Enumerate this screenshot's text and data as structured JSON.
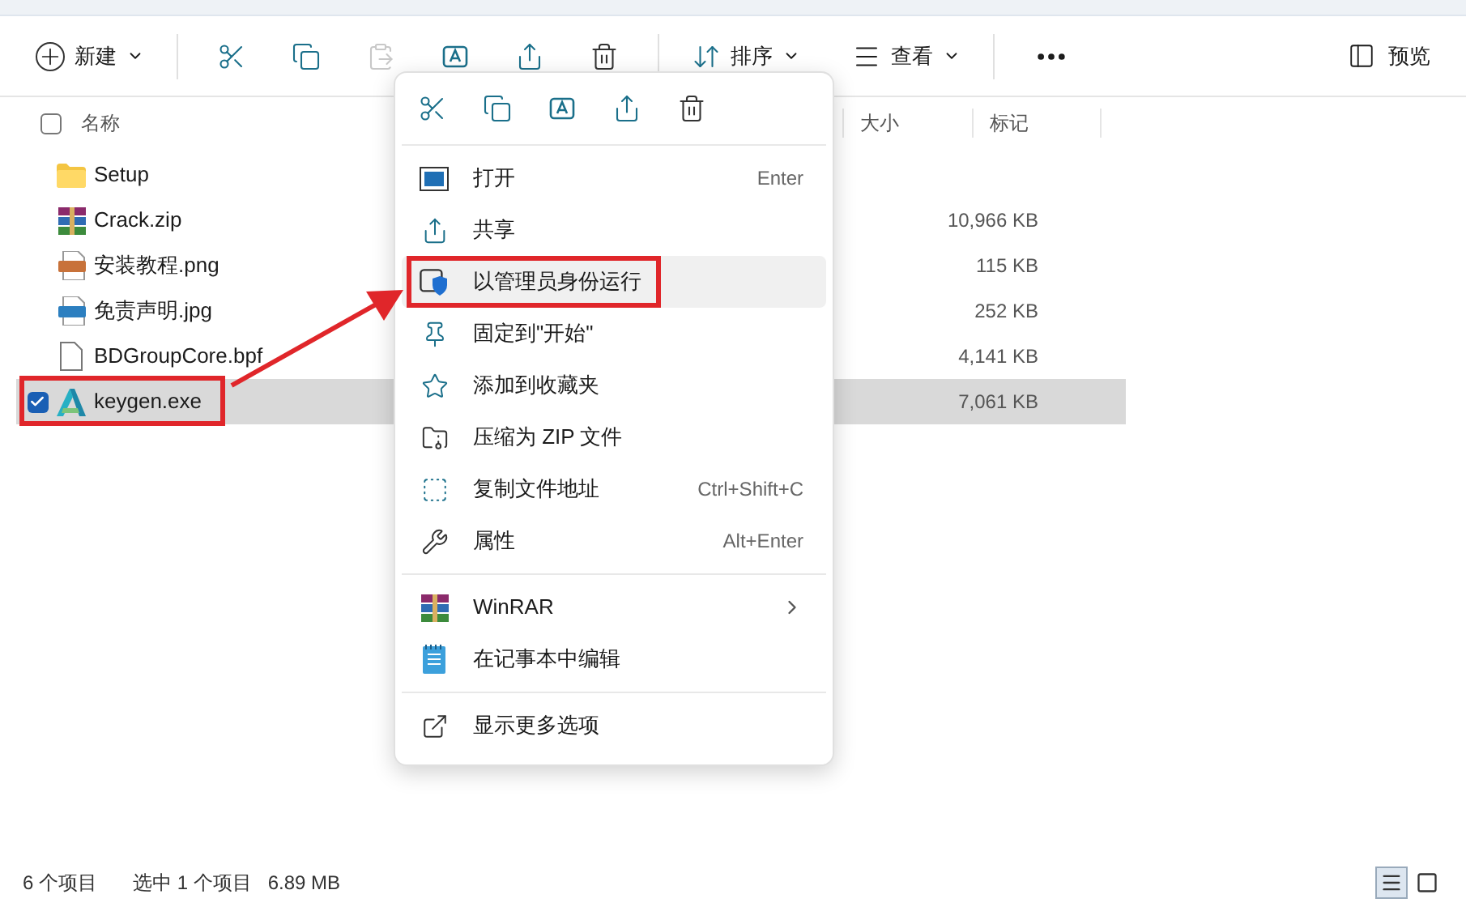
{
  "toolbar": {
    "new_label": "新建",
    "sort_label": "排序",
    "view_label": "查看",
    "preview_label": "预览"
  },
  "select_all_checked": false,
  "columns": [
    "名称",
    "大小",
    "标记"
  ],
  "files": [
    {
      "name": "Setup",
      "kind": "folder",
      "selected": false
    },
    {
      "name": "Crack.zip",
      "size": "10,966 KB",
      "kind": "archive",
      "selected": false
    },
    {
      "name": "安装教程.png",
      "size": "115 KB",
      "kind": "png",
      "selected": false
    },
    {
      "name": "免责声明.jpg",
      "size": "252 KB",
      "kind": "jpg",
      "selected": false
    },
    {
      "name": "BDGroupCore.bpf",
      "size": "4,141 KB",
      "kind": "file",
      "selected": false
    },
    {
      "name": "keygen.exe",
      "size": "7,061 KB",
      "kind": "app",
      "selected": true
    }
  ],
  "context_menu": {
    "sections": [
      [
        {
          "label": "打开",
          "shortcut": "Enter",
          "highlighted": false,
          "submenu": false
        },
        {
          "label": "共享",
          "highlighted": false,
          "submenu": false
        },
        {
          "label": "以管理员身份运行",
          "highlighted": true,
          "submenu": false
        },
        {
          "label": "固定到\"开始\"",
          "highlighted": false,
          "submenu": false
        },
        {
          "label": "添加到收藏夹",
          "highlighted": false,
          "submenu": false
        },
        {
          "label": "压缩为 ZIP 文件",
          "highlighted": false,
          "submenu": false
        },
        {
          "label": "复制文件地址",
          "shortcut": "Ctrl+Shift+C",
          "highlighted": false,
          "submenu": false
        },
        {
          "label": "属性",
          "shortcut": "Alt+Enter",
          "highlighted": false,
          "submenu": false
        }
      ],
      [
        {
          "label": "WinRAR",
          "highlighted": false,
          "submenu": true
        },
        {
          "label": "在记事本中编辑",
          "highlighted": false,
          "submenu": false
        }
      ],
      [
        {
          "label": "显示更多选项",
          "highlighted": false,
          "submenu": false
        }
      ]
    ]
  },
  "status_bar": {
    "item_count": "6 个项目",
    "selection": "选中 1 个项目",
    "selection_size": "6.89 MB"
  },
  "view_buttons": [
    {
      "kind": "details",
      "selected": true
    },
    {
      "kind": "tiles",
      "selected": false
    }
  ]
}
